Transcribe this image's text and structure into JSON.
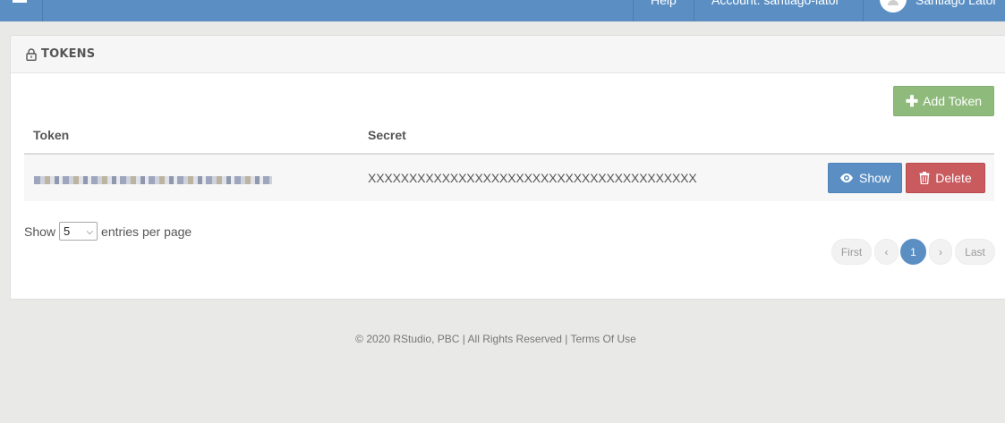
{
  "topbar": {
    "menu_icon": "hamburger-icon",
    "help": "Help",
    "account": "Account: santiago-lator",
    "user": "Santiago Lator",
    "accent": "#5b8fc4"
  },
  "panel": {
    "title": "TOKENS",
    "title_icon": "lock-icon",
    "add_button": "Add Token",
    "add_icon": "plus-icon",
    "columns": [
      "Token",
      "Secret"
    ],
    "rows": [
      {
        "token": "",
        "secret": "XXXXXXXXXXXXXXXXXXXXXXXXXXXXXXXXXXXXXXXX",
        "show_label": "Show",
        "delete_label": "Delete"
      }
    ],
    "show_label": "Show",
    "entries_value": "5",
    "entries_suffix": "entries per page",
    "pagination": {
      "first": "First",
      "prev": "‹",
      "current": "1",
      "next": "›",
      "last": "Last"
    }
  },
  "footer": {
    "copyright": "© 2020 RStudio, PBC | All Rights Reserved | ",
    "terms": "Terms Of Use"
  }
}
